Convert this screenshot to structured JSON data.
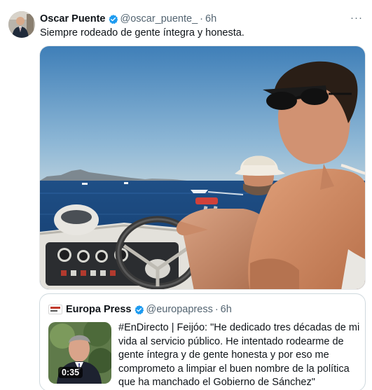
{
  "tweet": {
    "author": {
      "display_name": "Oscar Puente",
      "handle": "@oscar_puente_",
      "verified": true
    },
    "separator": "·",
    "time": "6h",
    "text": "Siempre rodeado de gente íntegra y honesta.",
    "more_label": "···"
  },
  "quoted_tweet": {
    "author": {
      "display_name": "Europa Press",
      "handle": "@europapress",
      "verified": true
    },
    "separator": "·",
    "time": "6h",
    "text_lines": [
      "#EnDirecto | Feijóo: \"He dedicado tres décadas de mi",
      "vida al servicio público. He intentado rodearme de",
      "gente íntegra y de gente honesta y por eso me",
      "comprometo a limpiar el buen nombre de la política",
      "que ha manchado el Gobierno de Sánchez\""
    ],
    "video_duration": "0:35"
  },
  "colors": {
    "verified_blue": "#1d9bf0",
    "text_primary": "#0f1419",
    "text_secondary": "#536471",
    "border": "#cfd9de"
  },
  "icons": {
    "verified": "verified-badge-icon",
    "more": "more-options-icon",
    "source_logo": "europa-press-logo-icon"
  }
}
